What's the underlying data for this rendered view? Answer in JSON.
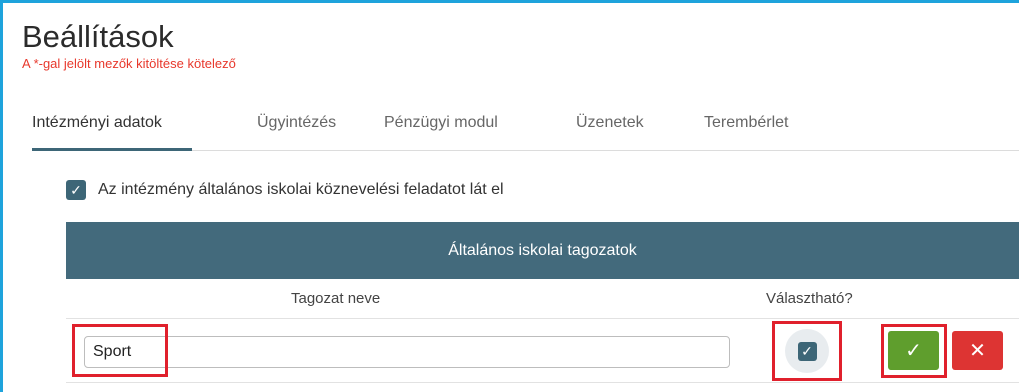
{
  "page": {
    "title": "Beállítások",
    "required_note": "A *-gal jelölt mezők kitöltése kötelező"
  },
  "tabs": [
    {
      "label": "Intézményi adatok",
      "active": true
    },
    {
      "label": "Ügyintézés",
      "active": false
    },
    {
      "label": "Pénzügyi modul",
      "active": false
    },
    {
      "label": "Üzenetek",
      "active": false
    },
    {
      "label": "Terembérlet",
      "active": false
    }
  ],
  "general_school": {
    "checkbox_label": "Az intézmény általános iskolai köznevelési feladatot lát el",
    "checked": true
  },
  "table": {
    "title": "Általános iskolai tagozatok",
    "columns": [
      "Tagozat neve",
      "Választható?"
    ],
    "row": {
      "name_value": "Sport",
      "selectable": true
    }
  },
  "icons": {
    "check": "✓",
    "close": "✕"
  },
  "colors": {
    "accent": "#436a7c",
    "ok": "#5f9e2d",
    "cancel": "#dd3433",
    "required": "#e8382c",
    "highlight": "#e0202c",
    "frame": "#1ea3dc"
  }
}
